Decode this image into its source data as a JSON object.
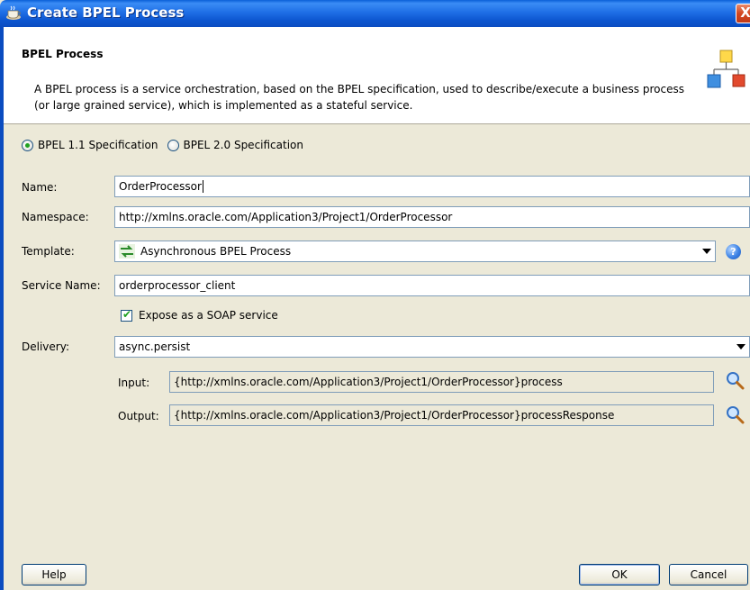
{
  "window": {
    "title": "Create BPEL Process",
    "close_glyph": "X"
  },
  "header": {
    "title": "BPEL Process",
    "description": "A BPEL process is a service orchestration, based on the BPEL specification, used to describe/execute a business process (or large grained service), which is implemented as a stateful service."
  },
  "spec": {
    "option1": "BPEL 1.1 Specification",
    "option2": "BPEL 2.0 Specification",
    "selected": "BPEL 1.1 Specification"
  },
  "form": {
    "name_label": "Name:",
    "name_value": "OrderProcessor",
    "namespace_label": "Namespace:",
    "namespace_value": "http://xmlns.oracle.com/Application3/Project1/OrderProcessor",
    "template_label": "Template:",
    "template_value": "Asynchronous BPEL Process",
    "service_name_label": "Service Name:",
    "service_name_value": "orderprocessor_client",
    "expose_label": "Expose as a SOAP service",
    "expose_checked": true,
    "delivery_label": "Delivery:",
    "delivery_value": "async.persist",
    "input_label": "Input:",
    "input_value": "{http://xmlns.oracle.com/Application3/Project1/OrderProcessor}process",
    "output_label": "Output:",
    "output_value": "{http://xmlns.oracle.com/Application3/Project1/OrderProcessor}processResponse"
  },
  "buttons": {
    "help": "Help",
    "ok": "OK",
    "cancel": "Cancel"
  },
  "icons": {
    "title": "coffee-cup-icon",
    "header": "process-diagram-icon",
    "template": "arrows-exchange-icon",
    "help": "help-icon",
    "browse": "magnifier-icon"
  }
}
